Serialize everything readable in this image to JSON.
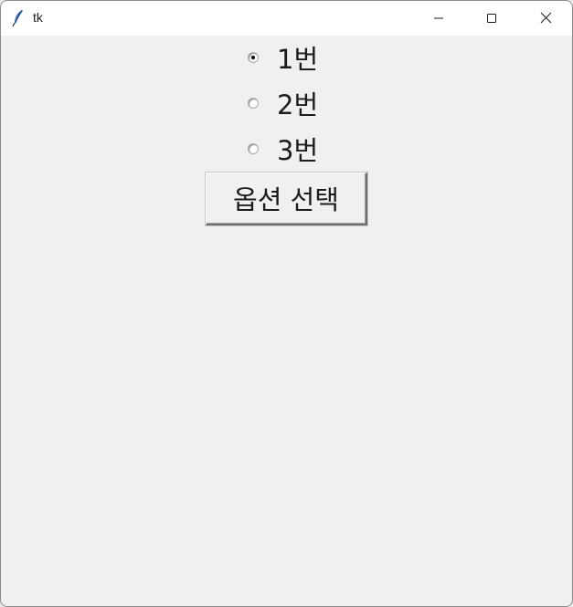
{
  "window": {
    "title": "tk"
  },
  "icons": {
    "app": "tk-feather-icon",
    "minimize": "minimize-icon",
    "maximize": "maximize-icon",
    "close": "close-icon"
  },
  "radio_group": {
    "selected_index": 0,
    "options": [
      {
        "label": "1번",
        "checked": true
      },
      {
        "label": "2번",
        "checked": false
      },
      {
        "label": "3번",
        "checked": false
      }
    ]
  },
  "actions": {
    "select_button_label": "옵션 선택"
  }
}
